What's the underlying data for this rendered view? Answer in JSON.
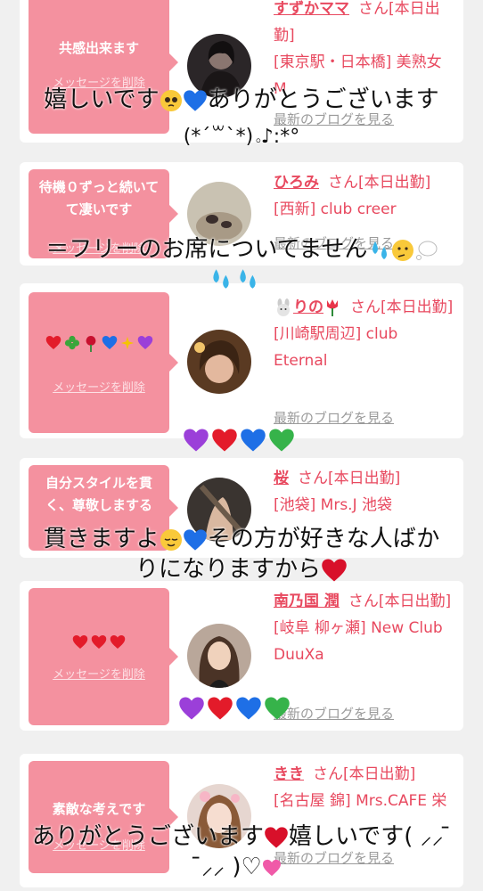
{
  "colors": {
    "pink": "#f4919f",
    "name_red": "#e8495f",
    "gray": "#9a9a9a"
  },
  "cards": [
    {
      "message": "共感出来ます",
      "delete": "メッセージを削除",
      "name": "すずかママ",
      "honorific": "さん[本日出勤]",
      "detail": "[東京駅・日本橋] 美熟女 M",
      "blog": "最新のブログを見る"
    },
    {
      "message": "待機０ずっと続いてて凄いです",
      "delete": "メッセージを削除",
      "name": "ひろみ",
      "honorific": "さん[本日出勤]",
      "detail": "[西新] club creer",
      "blog": "最新のブログを見る"
    },
    {
      "message": "",
      "message_icons": [
        "heart-red-icon",
        "clover-icon",
        "rose-icon",
        "heart-blue-icon",
        "sparkles-icon",
        "heart-purple-icon"
      ],
      "delete": "メッセージを削除",
      "name": "りの",
      "name_icons": [
        "rabbit-icon",
        "tulip-icon"
      ],
      "honorific": "さん[本日出勤]",
      "detail": "[川崎駅周辺] club Eternal",
      "blog": "最新のブログを見る"
    },
    {
      "message": "自分スタイルを貫く、尊敬しまする",
      "delete": "メッセージを削除",
      "name": "桜",
      "honorific": "さん[本日出勤]",
      "detail": "[池袋] Mrs.J 池袋",
      "blog": "最新のブログを見る"
    },
    {
      "message": "",
      "message_icons": [
        "heart-red-icon",
        "heart-red-icon",
        "heart-red-icon"
      ],
      "delete": "メッセージを削除",
      "name": "南乃国 潤",
      "honorific": "さん[本日出勤]",
      "detail": "[岐阜 柳ヶ瀬] New Club DuuXa",
      "blog": "最新のブログを見る"
    },
    {
      "message": "素敵な考えです",
      "delete": "メッセージを削除",
      "name": "きき",
      "honorific": "さん[本日出勤]",
      "detail": "[名古屋 錦] Mrs.CAFE 栄",
      "blog": "最新のブログを見る"
    }
  ],
  "overlays": {
    "text1": "嬉しいです",
    "text1b": "ありがとうございます",
    "text1c": "(*´꒳`*)｡♪:*°",
    "text2": "＝フリーのお席についてません",
    "text3": "貫きますよ",
    "text3b": "その方が好きな人ばか",
    "text3c": "りになりますから",
    "text4": "ありがとうございます",
    "text4b": "嬉しいです( ⸝⸝ ̄",
    "text4c": " ̄⸝⸝ )♡"
  }
}
